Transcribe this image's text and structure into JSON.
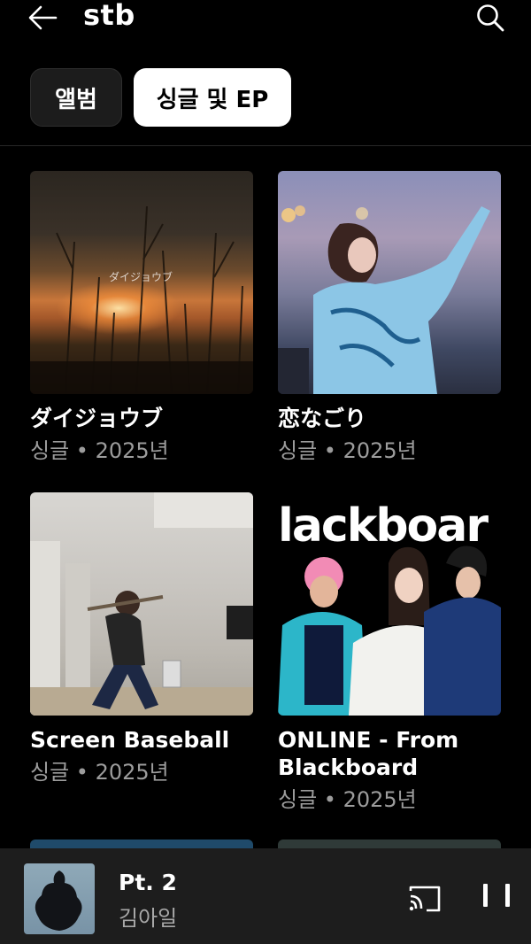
{
  "header": {
    "title": "stb",
    "back_icon": "arrow-left-icon",
    "search_icon": "search-icon"
  },
  "chips": {
    "albums": "앨범",
    "singles_eps": "싱글 및 EP",
    "selected": "singles_eps"
  },
  "items": [
    {
      "title": "ダイジョウブ",
      "meta": "싱글 • 2025년",
      "cover_text": "ダイジョウブ"
    },
    {
      "title": "恋なごり",
      "meta": "싱글 • 2025년"
    },
    {
      "title": "Screen Baseball",
      "meta": "싱글 • 2025년"
    },
    {
      "title": "ONLINE - From Blackboard",
      "meta": "싱글 • 2025년",
      "cover_text": "lackboar"
    }
  ],
  "now_playing": {
    "title": "Pt. 2",
    "artist": "김아일",
    "cast_icon": "cast-icon",
    "pause_icon": "pause-icon"
  },
  "colors": {
    "background": "#000000",
    "chip_selected_bg": "#ffffff",
    "chip_bg": "#1c1c1c",
    "meta_text": "#9c9c9c",
    "player_bg": "#1d1d1d"
  }
}
